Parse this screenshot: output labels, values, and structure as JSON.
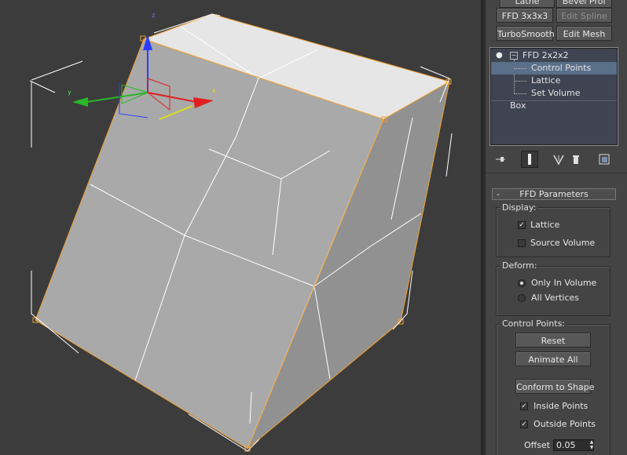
{
  "toolbar": {
    "top_buttons": [
      "Lathe",
      "Bevel Prof"
    ],
    "row1": {
      "left": "FFD 3x3x3",
      "right": "Edit Spline"
    },
    "row2": {
      "left": "TurboSmooth",
      "right": "Edit Mesh"
    }
  },
  "modifier_stack": {
    "modifier": "FFD 2x2x2",
    "sub_objects": [
      "Control Points",
      "Lattice",
      "Set Volume"
    ],
    "selected_sub_object": "Control Points",
    "base_object": "Box"
  },
  "stack_toolbar_icons": [
    "pin-stack-icon",
    "show-end-result-icon",
    "make-unique-icon",
    "remove-modifier-icon",
    "configure-modifier-sets-icon"
  ],
  "rollout": {
    "collapse_symbol": "-",
    "title": "FFD Parameters",
    "display": {
      "title": "Display:",
      "lattice": {
        "label": "Lattice",
        "checked": true
      },
      "source_volume": {
        "label": "Source Volume",
        "checked": false
      }
    },
    "deform": {
      "title": "Deform:",
      "only_in_volume": {
        "label": "Only In Volume",
        "selected": true
      },
      "all_vertices": {
        "label": "All Vertices",
        "selected": false
      }
    },
    "control_points": {
      "title": "Control Points:",
      "reset": "Reset",
      "animate_all": "Animate All",
      "conform": "Conform to Shape",
      "inside_points": {
        "label": "Inside Points",
        "checked": true
      },
      "outside_points": {
        "label": "Outside Points",
        "checked": true
      },
      "offset_label": "Offset :",
      "offset_value": "0.05"
    }
  },
  "viewport": {
    "gizmo_axes": [
      "x",
      "y",
      "z"
    ],
    "colors": {
      "background": "#3c3c3c",
      "lattice": "#f0a030",
      "face_top": "#e6e6e6",
      "face_front": "#a9a9a9",
      "face_side": "#8f8f8f",
      "edges": "#ffffff"
    }
  }
}
